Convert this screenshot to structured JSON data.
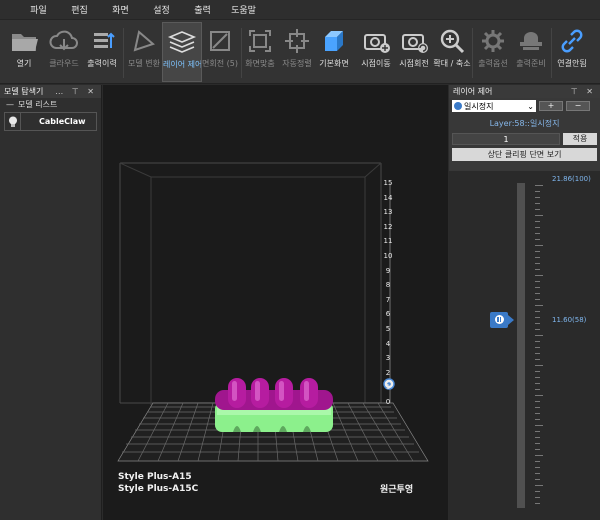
{
  "menu": [
    "파일",
    "편집",
    "화면",
    "설정",
    "출력",
    "도움말"
  ],
  "toolbar": {
    "open": "열기",
    "cloud": "클라우드",
    "history": "출력이력",
    "transform": "모델 변환",
    "layer_control": "레이어 제어",
    "layer_rotate": "면회전 (5)",
    "fit_screen": "화면맞춤",
    "auto_align": "자동정렬",
    "basic_screen": "기본화면",
    "view_move": "시점이동",
    "view_rotate": "시점회전",
    "zoom": "확대 / 축소",
    "print_option": "출력옵션",
    "print_ready": "출력준비",
    "connection": "연결안됨"
  },
  "left_panel": {
    "title": "모델 탐색기",
    "tree_root": "모델 리스트",
    "model_name": "CableClaw"
  },
  "viewport": {
    "z_ticks": [
      "15",
      "14",
      "13",
      "12",
      "11",
      "10",
      "9",
      "8",
      "7",
      "6",
      "5",
      "4",
      "3",
      "2",
      "1",
      "0"
    ],
    "printer_line1": "Style Plus-A15",
    "printer_line2": "Style Plus-A15C",
    "projection": "원근투영"
  },
  "right_panel": {
    "title": "레이어 제어",
    "mode_selected": "일시정지",
    "plus": "+",
    "minus": "−",
    "layer_info": "Layer:58::일시정지",
    "layer_input": "1",
    "apply": "적용",
    "clip": "상단 클리핑 단면 보기",
    "slider_top": "21.86(100)",
    "slider_current": "11.60(58)",
    "slider_fraction": 0.58
  },
  "colors": {
    "accent": "#3a7ac8",
    "model_top": "#b0189c",
    "model_base": "#8cf08c"
  }
}
